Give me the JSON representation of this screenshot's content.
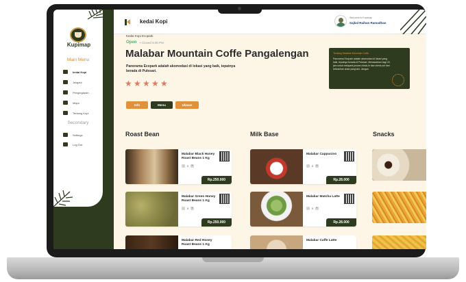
{
  "app": {
    "title": "kedai Kopi"
  },
  "brand": {
    "logo_text": "Kupimap"
  },
  "user": {
    "welcome": "Welcome to Kupimap",
    "name": "Sajkal Raihan Ramadhan"
  },
  "sidebar": {
    "main_heading": "Main Menu",
    "main_items": [
      {
        "label": "kedai Kopi",
        "icon": "coffee-shop-icon",
        "active": true
      },
      {
        "label": "Jelajahi",
        "icon": "explore-icon",
        "active": false
      },
      {
        "label": "Pengingapan",
        "icon": "lodging-icon",
        "active": false
      },
      {
        "label": "Maps",
        "icon": "map-icon",
        "active": false
      },
      {
        "label": "Tentang Kopi",
        "icon": "coffee-bean-icon",
        "active": false
      }
    ],
    "secondary_heading": "Secondary",
    "secondary_items": [
      {
        "label": "Settings",
        "icon": "settings-icon"
      },
      {
        "label": "Log Out",
        "icon": "logout-icon"
      }
    ]
  },
  "store": {
    "breadcrumb": "Kedai Kopi Ecopark",
    "status_open": "Open",
    "status_closed": "• Closed 9.00 PM",
    "title": "Malabar Mountain Coffe Pangalengan",
    "description": "Panorama Ecopark adalah akomodasi di lokasi yang baik, tepatnya berada di Pulesari.",
    "rating": 5,
    "buttons": {
      "info": "Info",
      "menu": "Menu",
      "ulasan": "Ulasan"
    }
  },
  "info_card": {
    "title": "Tentang Malabar Mountain Coffe",
    "text": "Panorama Ecopark adalah akomodasi di lokasi yang baik, tepatnya berada di Pulesari. Menawarkan bagi 24 jam untuk melayani proses check-in dan check-out dan kebutuhan anda yang lain. Jangan"
  },
  "sections": {
    "roast_bean": "Roast Bean",
    "milk_base": "Milk Base",
    "snacks": "Snacks"
  },
  "products": {
    "roast_bean": [
      {
        "name": "Malabar Black Honey Roast Beans 1 Kg",
        "price": "Rp.250.000",
        "qty": "0"
      },
      {
        "name": "Malabar Green Honey Roast Beans 1 Kg",
        "price": "Rp.250.000",
        "qty": "0"
      },
      {
        "name": "Malabar Red Honey Roast Beans 1 Kg",
        "price": "",
        "qty": ""
      }
    ],
    "milk_base": [
      {
        "name": "Malabar Cappucino",
        "price": "Rp.28.000",
        "qty": "0"
      },
      {
        "name": "Malabar Matcha Latte",
        "price": "Rp.28.000",
        "qty": "0"
      },
      {
        "name": "Malabar Caffe Latte",
        "price": "",
        "qty": ""
      }
    ]
  },
  "stepper": {
    "minus": "-",
    "plus": "+"
  },
  "colors": {
    "primary": "#2e3b1f",
    "accent": "#e0923a",
    "background": "#fdf6e6",
    "star": "#e07a5f",
    "open": "#4caf6e"
  }
}
